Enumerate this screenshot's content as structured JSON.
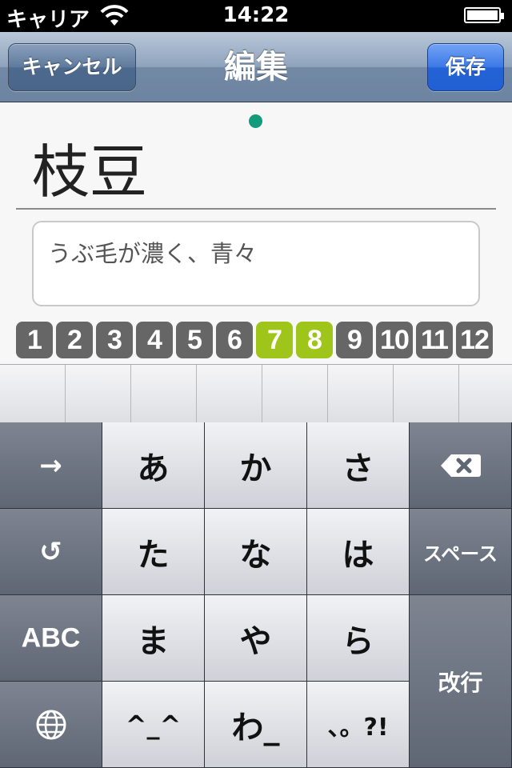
{
  "status_bar": {
    "carrier": "キャリア",
    "time": "14:22"
  },
  "nav": {
    "title": "編集",
    "cancel_label": "キャンセル",
    "save_label": "保存"
  },
  "content": {
    "word": "枝豆",
    "note": "うぶ毛が濃く、青々",
    "numbers": [
      "1",
      "2",
      "3",
      "4",
      "5",
      "6",
      "7",
      "8",
      "9",
      "10",
      "11",
      "12"
    ],
    "selected_numbers": [
      "7",
      "8"
    ],
    "accent_color": "#9fc51a"
  },
  "keyboard": {
    "rows": [
      {
        "left": "→",
        "keys": [
          "あ",
          "か",
          "さ"
        ],
        "right": "⌫"
      },
      {
        "left": "↺",
        "keys": [
          "た",
          "な",
          "は"
        ],
        "right": "スペース"
      },
      {
        "left": "ABC",
        "keys": [
          "ま",
          "や",
          "ら"
        ],
        "right": "改行"
      },
      {
        "left": "🌐",
        "keys": [
          "^_^",
          "わ_",
          "、。?!"
        ],
        "right": ""
      }
    ]
  }
}
